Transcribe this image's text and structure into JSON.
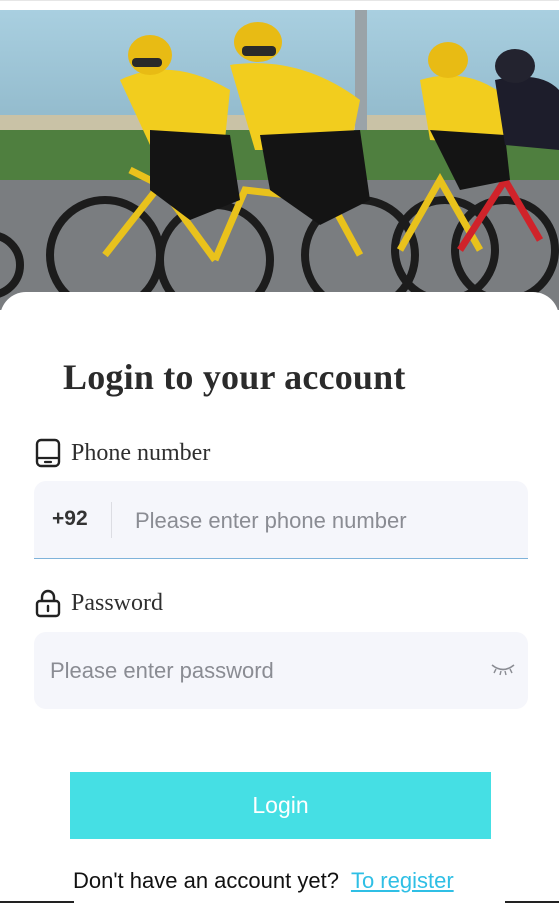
{
  "hero": {
    "image_alt": "photo-of-cyclists-racing"
  },
  "login": {
    "title": "Login to your account",
    "phone_label": "Phone number",
    "country_code": "+92",
    "phone_placeholder": "Please enter phone number",
    "password_label": "Password",
    "password_placeholder": "Please enter password",
    "button_label": "Login",
    "no_account_text": "Don't have an account yet?",
    "register_link": "To register"
  },
  "icons": {
    "phone": "tablet-phone-icon",
    "password": "padlock-icon",
    "toggle": "closed-eye-icon"
  },
  "colors": {
    "accent": "#45dfe4",
    "link": "#2fbfe5",
    "field_bg": "#f5f6fb",
    "title": "#2b2b2b"
  }
}
